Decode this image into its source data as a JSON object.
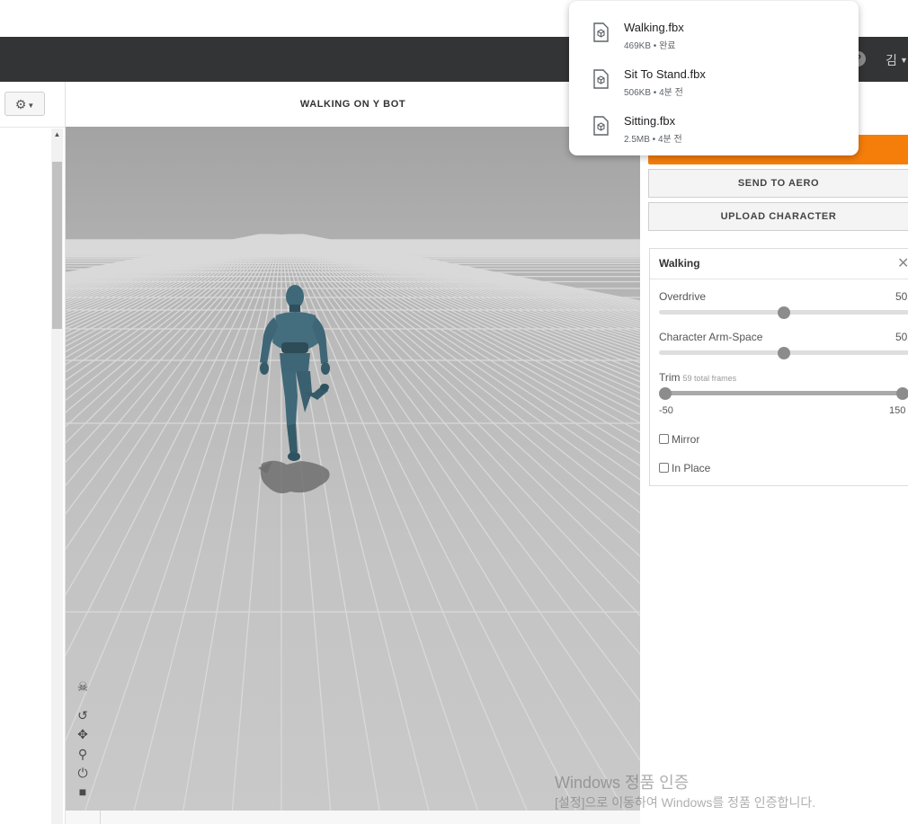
{
  "navbar": {
    "help_icon": "?",
    "user_label": "김"
  },
  "left_panel": {
    "settings_icon": "⚙"
  },
  "viewport": {
    "title": "WALKING ON Y BOT",
    "tools": [
      "skeleton-icon",
      "rotate-reset-icon",
      "pan-icon",
      "zoom-icon",
      "power-icon",
      "camera-icon"
    ]
  },
  "right_panel": {
    "accent_color": "#f57d0a",
    "send_button": "SEND TO AERO",
    "upload_button": "UPLOAD CHARACTER",
    "settings": {
      "title": "Walking",
      "overdrive": {
        "label": "Overdrive",
        "value": "50",
        "fraction": 0.5
      },
      "arm_space": {
        "label": "Character Arm-Space",
        "value": "50",
        "fraction": 0.5
      },
      "trim": {
        "label": "Trim",
        "sublabel": "59 total frames",
        "min_label": "-50",
        "max_label": "150",
        "start_fraction": 0.0,
        "end_fraction": 1.0
      },
      "mirror": "Mirror",
      "in_place": "In Place"
    }
  },
  "downloads": [
    {
      "name": "Walking.fbx",
      "meta": "469KB • 완료"
    },
    {
      "name": "Sit To Stand.fbx",
      "meta": "506KB • 4분 전"
    },
    {
      "name": "Sitting.fbx",
      "meta": "2.5MB • 4분 전"
    }
  ],
  "watermark": {
    "title": "Windows 정품 인증",
    "subtitle": "[설정]으로 이동하여 Windows를 정품 인증합니다."
  }
}
